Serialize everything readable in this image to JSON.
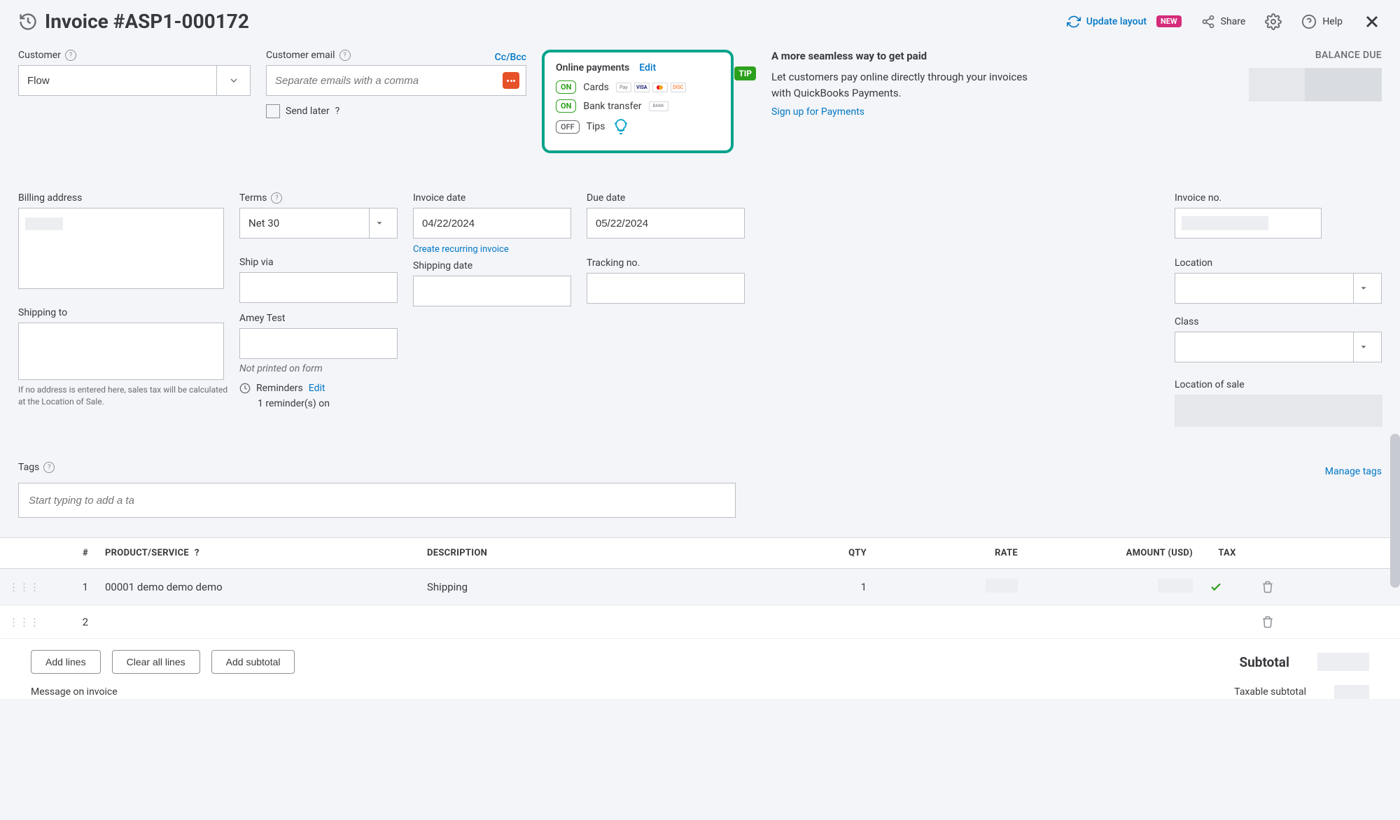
{
  "header": {
    "title": "Invoice #ASP1-000172",
    "update_layout": "Update layout",
    "new_badge": "NEW",
    "share": "Share",
    "help": "Help"
  },
  "customer": {
    "label": "Customer",
    "value": "Flow"
  },
  "email": {
    "label": "Customer email",
    "ccbcc": "Cc/Bcc",
    "placeholder": "Separate emails with a comma",
    "send_later": "Send later"
  },
  "payments": {
    "heading": "Online payments",
    "edit": "Edit",
    "tip": "TIP",
    "cards": "Cards",
    "bank": "Bank transfer",
    "tips": "Tips",
    "on": "ON",
    "off": "OFF",
    "card_brands": [
      "Pay",
      "VISA",
      "MC",
      "DISC"
    ],
    "bank_badge": "BANK"
  },
  "promo": {
    "title": "A more seamless way to get paid",
    "body": "Let customers pay online directly through your invoices with QuickBooks Payments.",
    "link": "Sign up for Payments"
  },
  "balance": {
    "label": "BALANCE DUE"
  },
  "fields": {
    "billing_address": "Billing address",
    "terms": "Terms",
    "terms_value": "Net 30",
    "invoice_date": "Invoice date",
    "invoice_date_value": "04/22/2024",
    "due_date": "Due date",
    "due_date_value": "05/22/2024",
    "invoice_no": "Invoice no.",
    "create_recurring": "Create recurring invoice",
    "ship_via": "Ship via",
    "shipping_date": "Shipping date",
    "tracking_no": "Tracking no.",
    "location": "Location",
    "shipping_to": "Shipping to",
    "shipping_note": "If no address is entered here, sales tax will be calculated at the Location of Sale.",
    "amey_test": "Amey Test",
    "not_printed": "Not printed on form",
    "class": "Class",
    "reminders": "Reminders",
    "reminders_edit": "Edit",
    "reminders_count": "1 reminder(s) on",
    "location_of_sale": "Location of sale"
  },
  "tags": {
    "label": "Tags",
    "manage": "Manage tags",
    "placeholder": "Start typing to add a ta"
  },
  "table": {
    "headers": {
      "num": "#",
      "product": "PRODUCT/SERVICE",
      "description": "DESCRIPTION",
      "qty": "QTY",
      "rate": "RATE",
      "amount": "AMOUNT (USD)",
      "tax": "TAX"
    },
    "rows": [
      {
        "num": "1",
        "product": "00001 demo demo demo",
        "description": "Shipping",
        "qty": "1",
        "tax_checked": true
      },
      {
        "num": "2",
        "product": "",
        "description": "",
        "qty": "",
        "tax_checked": false
      }
    ],
    "add_lines": "Add lines",
    "clear_all": "Clear all lines",
    "add_subtotal": "Add subtotal"
  },
  "totals": {
    "subtotal": "Subtotal",
    "taxable_subtotal": "Taxable subtotal"
  },
  "message": {
    "label": "Message on invoice"
  }
}
